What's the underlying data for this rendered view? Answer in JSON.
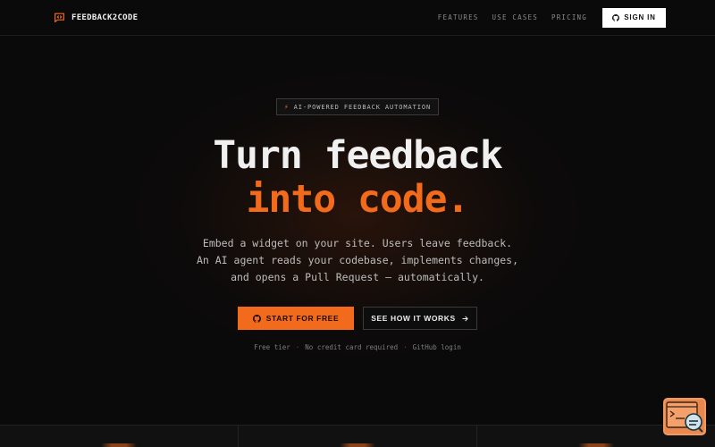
{
  "brand": {
    "name": "FEEDBACK2CODE",
    "icon": "message-square-code-icon"
  },
  "nav": {
    "links": [
      "FEATURES",
      "USE CASES",
      "PRICING"
    ],
    "signin_label": "SIGN IN",
    "signin_icon": "github-icon"
  },
  "hero": {
    "badge_icon": "sparkle-icon",
    "badge": "AI-POWERED FEEDBACK AUTOMATION",
    "title_line1": "Turn feedback",
    "title_line2": "into code.",
    "subtitle": [
      "Embed a widget on your site. Users leave feedback.",
      "An AI agent reads your codebase, implements changes,",
      "and opens a Pull Request — automatically."
    ],
    "cta_primary": "START FOR FREE",
    "cta_primary_icon": "github-icon",
    "cta_secondary": "SEE HOW IT WORKS",
    "cta_secondary_icon": "arrow-right-icon",
    "fine_print": [
      "Free tier",
      "No credit card required",
      "GitHub login"
    ],
    "fine_separator": "·"
  },
  "widget": {
    "icon": "feedback-widget-icon"
  },
  "colors": {
    "accent": "#f26b1d",
    "background": "#0a0a0a",
    "text": "#f0f0f0",
    "muted": "#8a8a8a"
  }
}
